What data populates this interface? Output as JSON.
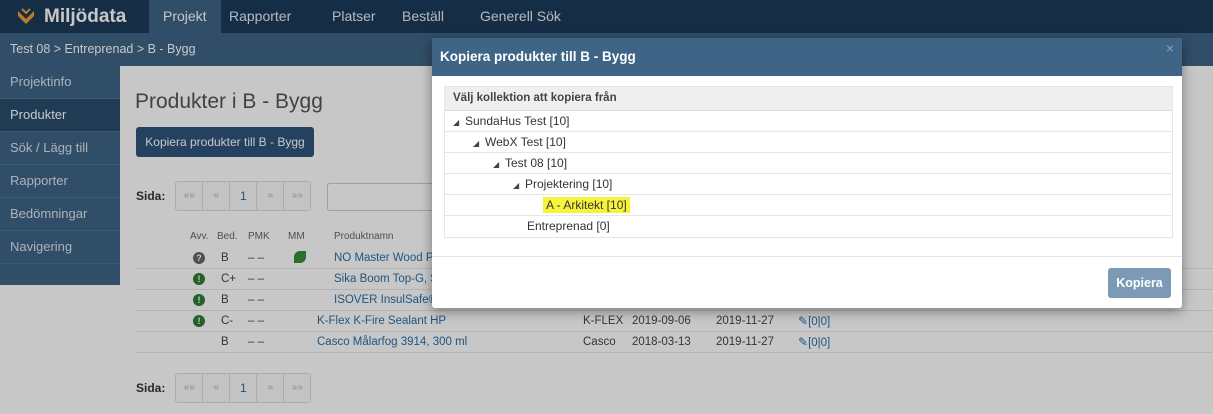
{
  "app": {
    "brand": "Miljödata"
  },
  "nav": [
    "Projekt",
    "Rapporter",
    "Platser",
    "Beställ",
    "Generell Sök"
  ],
  "breadcrumb": "Test 08  >  Entreprenad  >  B - Bygg",
  "sidebar": [
    "Projektinfo",
    "Produkter",
    "Sök / Lägg till",
    "Rapporter",
    "Bedömningar",
    "Navigering"
  ],
  "page": {
    "title": "Produkter i B - Bygg",
    "copy_button": "Kopiera produkter till B - Bygg"
  },
  "pager": {
    "label": "Sida:",
    "first": "««",
    "prev": "«",
    "current": "1",
    "next": "»",
    "last": "»»"
  },
  "table": {
    "headers": [
      "Avv.",
      "Bed.",
      "PMK",
      "MM",
      "Produktnamn"
    ],
    "rows": [
      {
        "icon": "?",
        "bed": "B",
        "pmk": "– –",
        "mm": "leaf",
        "name": "NO Master Wood P",
        "maker": "",
        "date1": "",
        "date2": "",
        "links": ""
      },
      {
        "icon": "!",
        "bed": "C+",
        "pmk": "– –",
        "mm": "",
        "name": "Sika Boom Top-G, S",
        "maker": "",
        "date1": "",
        "date2": "",
        "links": ""
      },
      {
        "icon": "!",
        "bed": "B",
        "pmk": "– –",
        "mm": "",
        "name": "ISOVER InsulSafe®",
        "maker": "",
        "date1": "",
        "date2": "",
        "links": ""
      },
      {
        "icon": "!",
        "bed": "C-",
        "pmk": "– –",
        "mm": "",
        "name": "K-Flex K-Fire Sealant HP",
        "maker": "K-FLEX",
        "date1": "2019-09-06",
        "date2": "2019-11-27",
        "links": "[0|0]"
      },
      {
        "icon": "",
        "bed": "B",
        "pmk": "– –",
        "mm": "",
        "name": "Casco Målarfog 3914, 300 ml",
        "maker": "Casco",
        "date1": "2018-03-13",
        "date2": "2019-11-27",
        "links": "[0|0]"
      }
    ]
  },
  "modal": {
    "title": "Kopiera produkter till B - Bygg",
    "close": "×",
    "panel_title": "Välj kollektion att kopiera från",
    "tree": [
      {
        "label": "SundaHus Test  [10]",
        "level": 0,
        "expanded": true
      },
      {
        "label": "WebX Test  [10]",
        "level": 1,
        "expanded": true
      },
      {
        "label": "Test 08  [10]",
        "level": 2,
        "expanded": true
      },
      {
        "label": "Projektering  [10]",
        "level": 3,
        "expanded": true
      },
      {
        "label": "A - Arkitekt  [10]",
        "level": 4,
        "highlight": true
      },
      {
        "label": "Entreprenad  [0]",
        "level": 4
      }
    ],
    "button": "Kopiera"
  }
}
